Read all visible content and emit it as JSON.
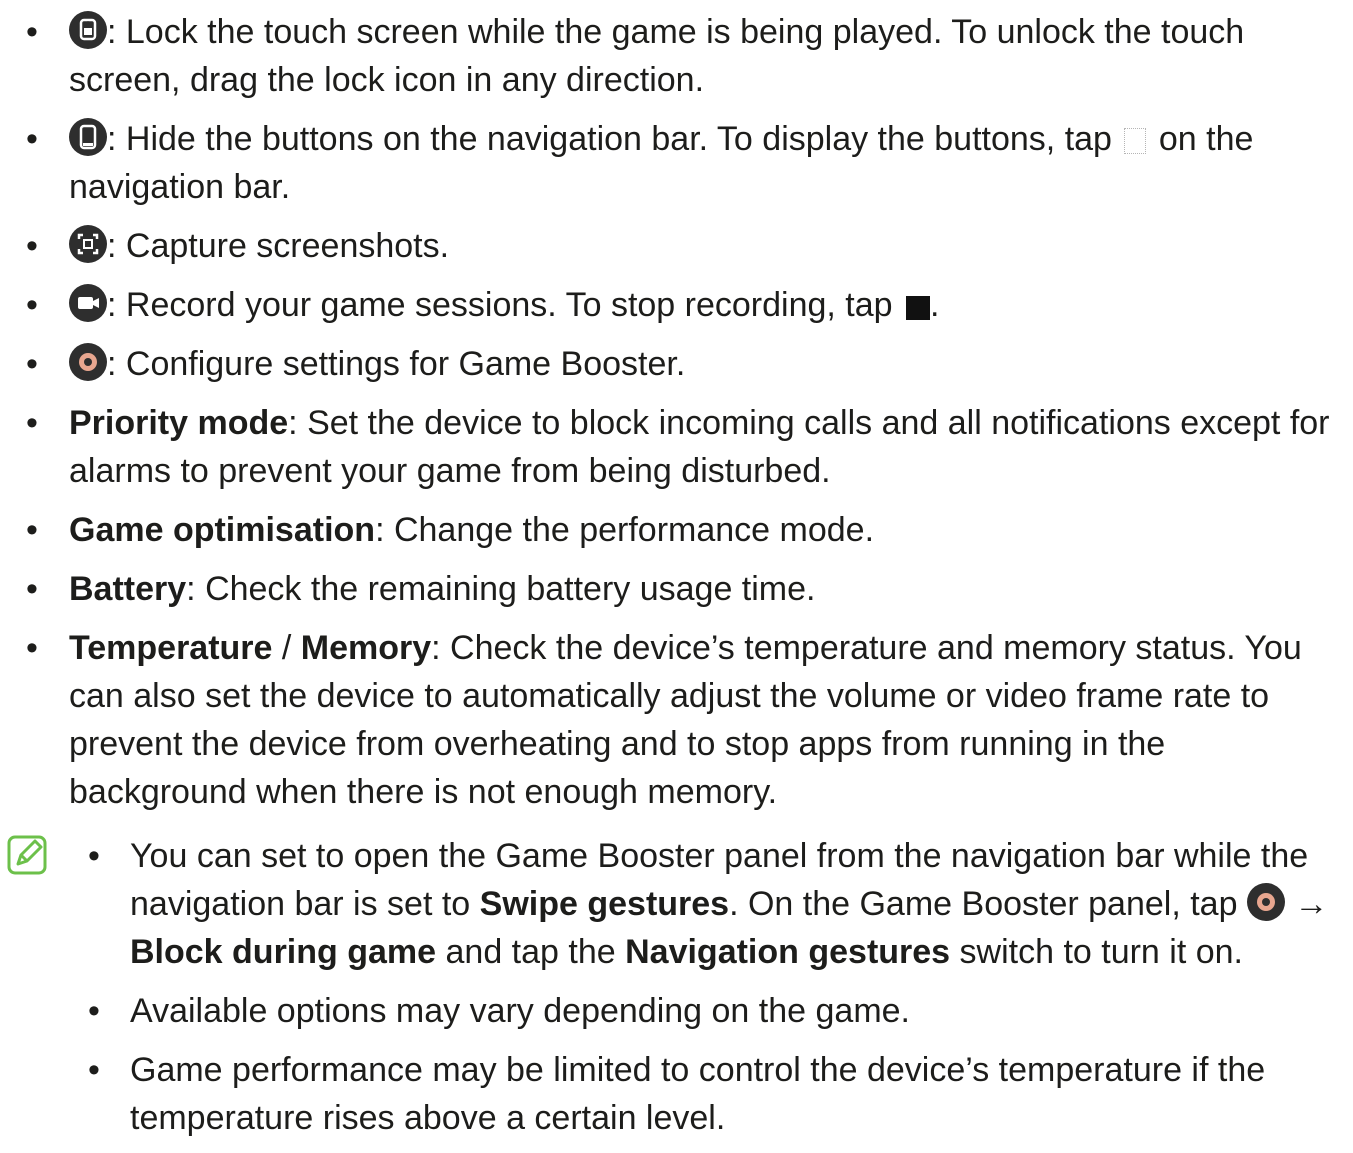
{
  "icon_items": [
    {
      "icon": "lock-icon",
      "text": ": Lock the touch screen while the game is being played. To unlock the touch screen, drag the lock icon in any direction."
    },
    {
      "icon": "hide-navigation-icon",
      "text_a": ": Hide the buttons on the navigation bar. To display the buttons, tap ",
      "inline_icon": "navigation-hint-icon",
      "text_b": " on the navigation bar."
    },
    {
      "icon": "screenshot-icon",
      "text": ": Capture screenshots."
    },
    {
      "icon": "record-icon",
      "text_a": ": Record your game sessions. To stop recording, tap ",
      "inline_icon": "stop-icon",
      "text_b": "."
    },
    {
      "icon": "settings-icon",
      "text": ": Configure settings for Game Booster."
    }
  ],
  "feature_items": [
    {
      "label": "Priority mode",
      "text": ": Set the device to block incoming calls and all notifications except for alarms to prevent your game from being disturbed."
    },
    {
      "label": "Game optimisation",
      "text": ": Change the performance mode."
    },
    {
      "label": "Battery",
      "text": ": Check the remaining battery usage time."
    },
    {
      "label": "Temperature",
      "separator": " / ",
      "label2": "Memory",
      "text": ": Check the device’s temperature and memory status. You can also set the device to automatically adjust the volume or video frame rate to prevent the device from overheating and to stop apps from running in the background when there is not enough memory."
    }
  ],
  "note": {
    "icon": "note-pencil-icon",
    "items": [
      {
        "t1": "You can set to open the Game Booster panel from the navigation bar while the navigation bar is set to ",
        "b1": "Swipe gestures",
        "t2": ". On the Game Booster panel, tap ",
        "inline_icon": "settings-icon",
        "arrow": " → ",
        "b2": "Block during game",
        "t3": " and tap the ",
        "b3": "Navigation gestures",
        "t4": " switch to turn it on."
      },
      {
        "text": "Available options may vary depending on the game."
      },
      {
        "text": "Game performance may be limited to control the device’s temperature if the temperature rises above a certain level."
      }
    ]
  },
  "bullet_char": "•",
  "colors": {
    "text": "#1d1d1b",
    "icon_bg": "#2e2e2e",
    "note_green": "#6cc04a"
  }
}
